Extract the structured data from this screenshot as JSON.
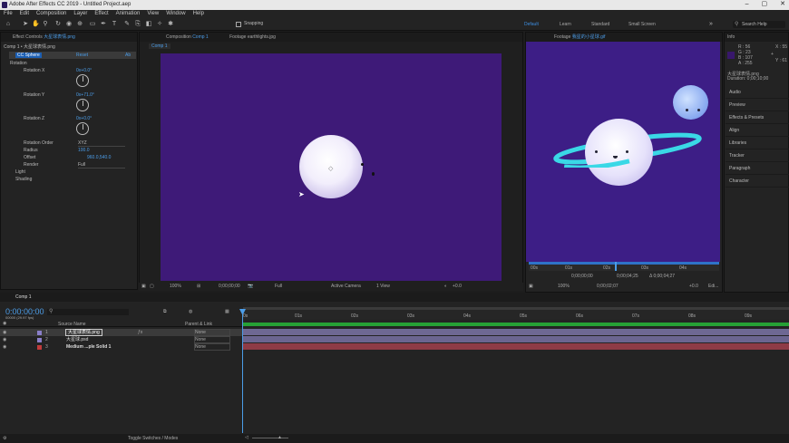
{
  "app": {
    "title": "Adobe After Effects CC 2019 - Untitled Project.aep"
  },
  "menu": [
    "File",
    "Edit",
    "Composition",
    "Layer",
    "Effect",
    "Animation",
    "View",
    "Window",
    "Help"
  ],
  "toolbar": {
    "snapping": "Snapping",
    "search_placeholder": "Search Help"
  },
  "workspaces": [
    "Default",
    "Learn",
    "Standard",
    "Small Screen"
  ],
  "effect_controls": {
    "tab_label": "Effect Controls",
    "tab_target": "大星球表情.png",
    "comp_label": "Comp 1 • 大星球表情.png",
    "effect_name": "CC Sphere",
    "reset": "Reset",
    "about": "Ab",
    "rotation": "Rotation",
    "rot_x_label": "Rotation X",
    "rot_x_val": "0x+0.0°",
    "rot_y_label": "Rotation Y",
    "rot_y_val": "0x+71.0°",
    "rot_z_label": "Rotation Z",
    "rot_z_val": "0x+0.0°",
    "rot_order_label": "Rotation Order",
    "rot_order_val": "XYZ",
    "radius_label": "Radius",
    "radius_val": "100.0",
    "offset_label": "Offset",
    "offset_val": "960.0,540.0",
    "render_label": "Render",
    "render_val": "Full",
    "light": "Light",
    "shading": "Shading"
  },
  "composition": {
    "tab_label": "Composition",
    "tab_target": "Comp 1",
    "footage_tab": "Footage earthlights.jpg",
    "breadcrumb": "Comp 1",
    "zoom": "100%",
    "timecode": "0;00;00;00",
    "resolution": "Full",
    "camera": "Active Camera",
    "views": "1 View",
    "exposure": "+0.0"
  },
  "footage": {
    "tab_label": "Footage",
    "tab_target": "我星的小星球.gif",
    "ruler": [
      "00s",
      "01s",
      "02s",
      "03s",
      "04s"
    ],
    "timecode_start": "0;00;00;00",
    "timecode_end": "0;00;04;25",
    "duration": "Δ 0;00;04;27",
    "zoom": "100%",
    "timecode": "0;00;02;07",
    "exposure": "+0.0",
    "edit": "Edi..."
  },
  "info": {
    "title": "Info",
    "r": "R : 56",
    "g": "G : 23",
    "b": "B : 107",
    "a": "A : 255",
    "x": "X : 55",
    "y": "Y : 61",
    "file": "大星球表情.png",
    "duration": "Duration: 0;00;10;00"
  },
  "right_panels": [
    "Audio",
    "Preview",
    "Effects & Presets",
    "Align",
    "Libraries",
    "Tracker",
    "Paragraph",
    "Character"
  ],
  "timeline": {
    "tab": "Comp 1",
    "timecode": "0:00:00:00",
    "fps": "00000 (29.97 fps)",
    "col_source": "Source Name",
    "col_parent": "Parent & Link",
    "ruler": [
      "0s",
      "01s",
      "02s",
      "03s",
      "04s",
      "05s",
      "06s",
      "07s",
      "08s",
      "09s"
    ],
    "layers": [
      {
        "num": "1",
        "name": "大星球表情.png",
        "parent": "None",
        "color": "#8a7fc9"
      },
      {
        "num": "2",
        "name": "大星球.psd",
        "parent": "None",
        "color": "#8a7fc9"
      },
      {
        "num": "3",
        "name": "Medium ...ple Solid 1",
        "parent": "None",
        "color": "#c23b3b"
      }
    ],
    "toggle": "Toggle Switches / Modes"
  },
  "colors": {
    "accent": "#4c9de8",
    "comp_bg": "#3e1a78",
    "footage_bg": "#3d1e86",
    "ring": "#3ad8e6"
  }
}
